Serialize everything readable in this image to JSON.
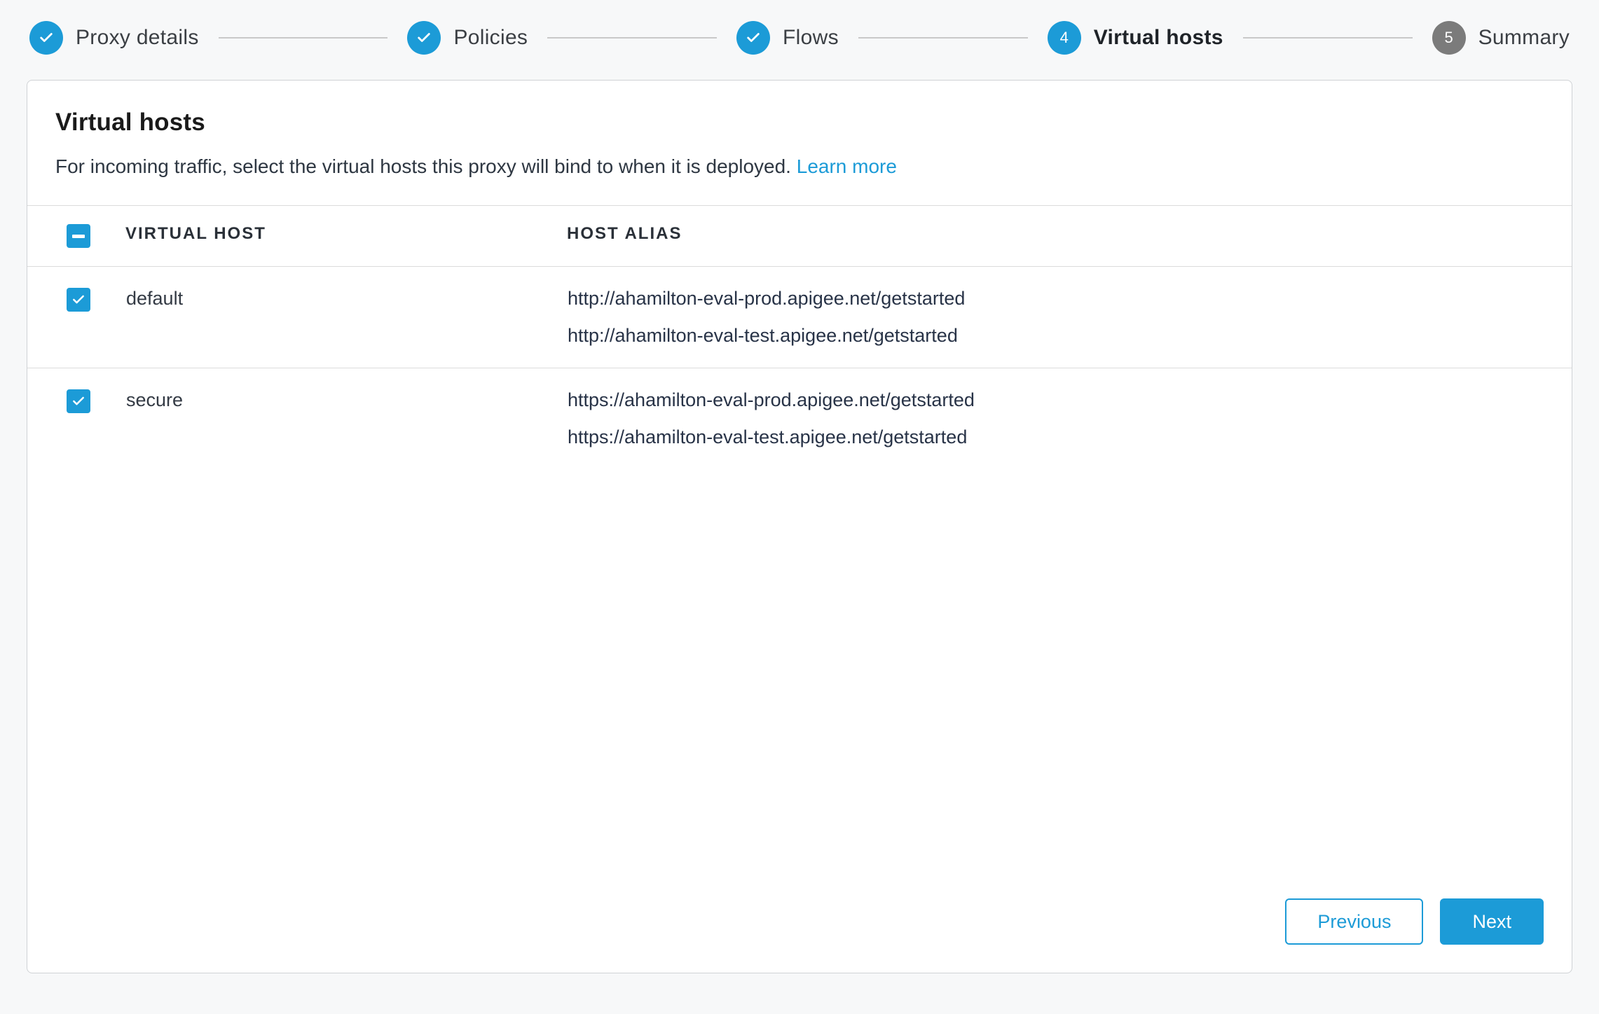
{
  "stepper": {
    "steps": [
      {
        "label": "Proxy details",
        "state": "done"
      },
      {
        "label": "Policies",
        "state": "done"
      },
      {
        "label": "Flows",
        "state": "done"
      },
      {
        "label": "Virtual hosts",
        "state": "active",
        "number": "4"
      },
      {
        "label": "Summary",
        "state": "pending",
        "number": "5"
      }
    ]
  },
  "panel": {
    "title": "Virtual hosts",
    "description": "For incoming traffic, select the virtual hosts this proxy will bind to when it is deployed. ",
    "learn_more": "Learn more"
  },
  "table": {
    "header_check_state": "indeterminate",
    "columns": {
      "virtual_host": "VIRTUAL HOST",
      "host_alias": "HOST ALIAS"
    },
    "rows": [
      {
        "checked": true,
        "name": "default",
        "aliases": [
          "http://ahamilton-eval-prod.apigee.net/getstarted",
          "http://ahamilton-eval-test.apigee.net/getstarted"
        ]
      },
      {
        "checked": true,
        "name": "secure",
        "aliases": [
          "https://ahamilton-eval-prod.apigee.net/getstarted",
          "https://ahamilton-eval-test.apigee.net/getstarted"
        ]
      }
    ]
  },
  "footer": {
    "previous": "Previous",
    "next": "Next"
  }
}
